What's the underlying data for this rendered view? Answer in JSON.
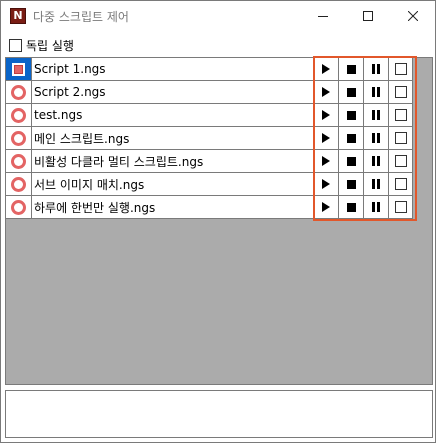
{
  "window": {
    "title": "다중 스크립트 제어",
    "app_icon_letter": "N",
    "app_icon_color": "#7a1d14"
  },
  "independent_run": {
    "label": "독립 실행",
    "checked": false
  },
  "scripts": [
    {
      "name": "Script 1.ngs",
      "selected": true
    },
    {
      "name": "Script 2.ngs",
      "selected": false
    },
    {
      "name": "test.ngs",
      "selected": false
    },
    {
      "name": "메인 스크립트.ngs",
      "selected": false
    },
    {
      "name": "비활성 다클라 멀티 스크립트.ngs",
      "selected": false
    },
    {
      "name": "서브 이미지 매치.ngs",
      "selected": false
    },
    {
      "name": "하루에 한번만 실행.ngs",
      "selected": false
    }
  ],
  "controls": {
    "play_icon": "play-icon",
    "stop_icon": "stop-icon",
    "pause_icon": "pause-icon",
    "checkbox": "checkbox"
  },
  "colors": {
    "accent_highlight": "#e2572b",
    "status_ring": "#e36464",
    "selection": "#0a64c8",
    "grid_background": "#ababab"
  },
  "output": {
    "text": ""
  }
}
